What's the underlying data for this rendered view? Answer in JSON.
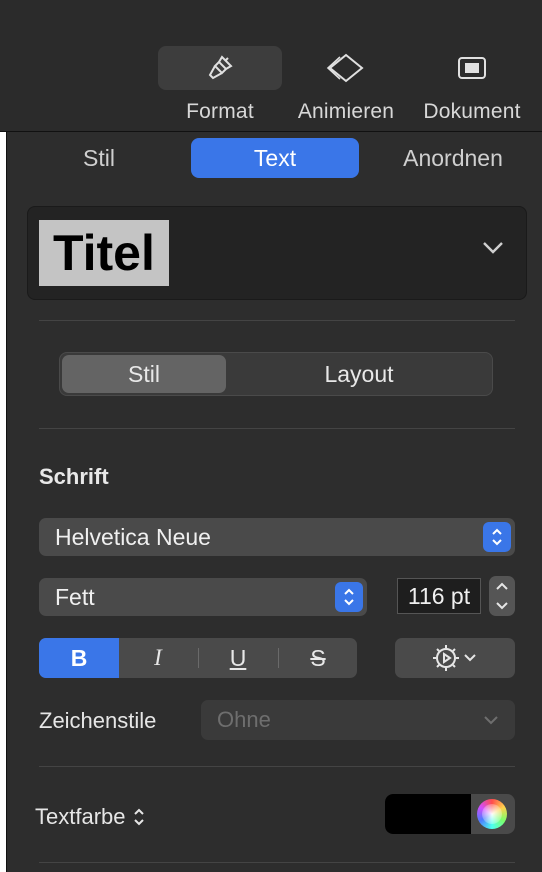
{
  "toolbar": {
    "format_label": "Format",
    "animate_label": "Animieren",
    "document_label": "Dokument"
  },
  "tabs": {
    "style": "Stil",
    "text": "Text",
    "arrange": "Anordnen"
  },
  "paragraph_style": {
    "name": "Titel"
  },
  "segment": {
    "style": "Stil",
    "layout": "Layout"
  },
  "font": {
    "section_title": "Schrift",
    "family": "Helvetica Neue",
    "typeface": "Fett",
    "size": "116 pt"
  },
  "format_buttons": {
    "bold": "B",
    "italic": "I",
    "underline": "U",
    "strike": "S"
  },
  "character_styles": {
    "label": "Zeichenstile",
    "value": "Ohne"
  },
  "text_color": {
    "label": "Textfarbe",
    "value": "#000000"
  },
  "colors": {
    "accent": "#3a76e8",
    "background": "#2d2d2d"
  }
}
